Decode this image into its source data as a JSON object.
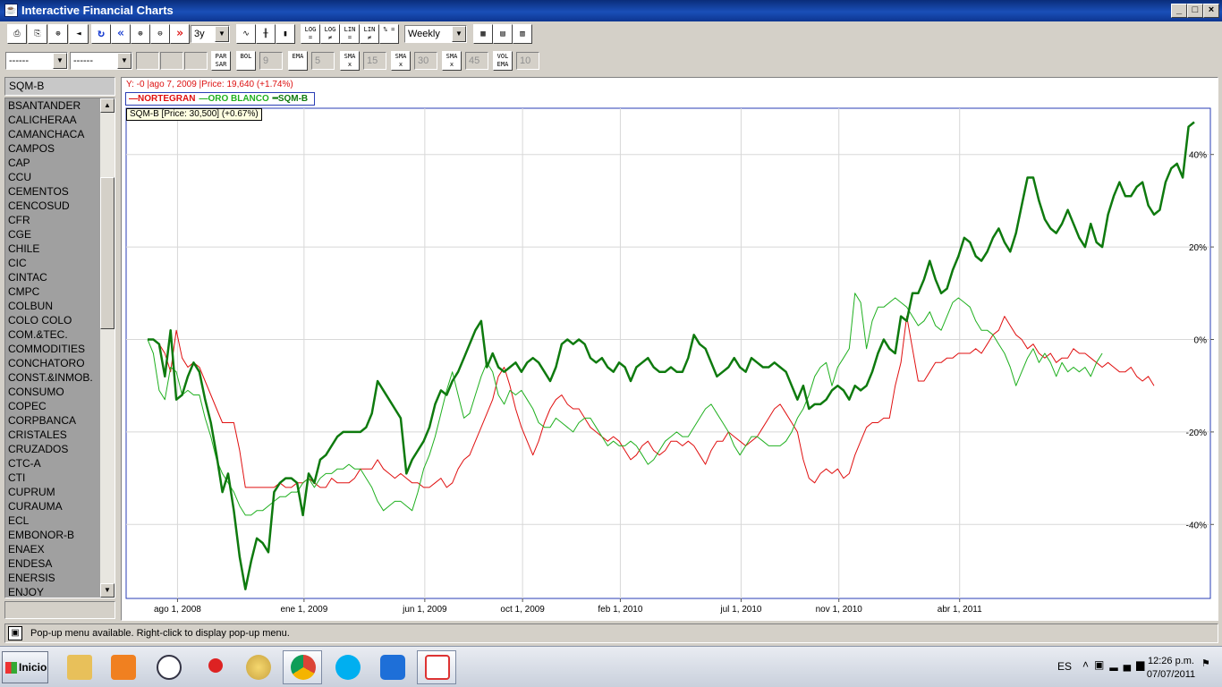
{
  "window": {
    "title": "Interactive Financial Charts",
    "app_icon": "java-icon"
  },
  "toolbar1": {
    "buttons": [
      {
        "name": "print-icon",
        "glyph": "⎙"
      },
      {
        "name": "print-preview-icon",
        "glyph": "⎘"
      },
      {
        "name": "crosshair-icon",
        "glyph": "⊕"
      },
      {
        "name": "sound-icon",
        "glyph": "◄"
      },
      {
        "name": "refresh-icon",
        "glyph": "↻"
      },
      {
        "name": "back-icon",
        "glyph": "«"
      },
      {
        "name": "zoom-in-icon",
        "glyph": "⊕"
      },
      {
        "name": "zoom-out-icon",
        "glyph": "⊖"
      },
      {
        "name": "forward-icon",
        "glyph": "»"
      }
    ],
    "period": "3y",
    "chart_types": [
      {
        "name": "line-chart-icon",
        "glyph": "∿"
      },
      {
        "name": "ohlc-chart-icon",
        "glyph": "╫"
      },
      {
        "name": "candlestick-icon",
        "glyph": "▮"
      }
    ],
    "scale_buttons": [
      "LOG =",
      "LOG ≠",
      "LIN =",
      "LIN ≠",
      "% ="
    ],
    "interval": "Weekly",
    "view_buttons": [
      {
        "name": "color-settings-icon",
        "glyph": "▦"
      },
      {
        "name": "chart-window-icon",
        "glyph": "▤"
      },
      {
        "name": "chart-window-alt-icon",
        "glyph": "▥"
      }
    ]
  },
  "toolbar2": {
    "select1": "------",
    "select2": "------",
    "indicators": [
      {
        "label": "PAR SAR",
        "value": ""
      },
      {
        "label": "BOL",
        "value": "9"
      },
      {
        "label": "EMA",
        "value": "5"
      },
      {
        "label": "SMA x",
        "value": "15"
      },
      {
        "label": "SMA x",
        "value": "30"
      },
      {
        "label": "SMA x",
        "value": "45"
      },
      {
        "label": "VOL EMA",
        "value": "10"
      }
    ]
  },
  "sidebar": {
    "selected": "SQM-B",
    "items": [
      "BSANTANDER",
      "CALICHERAA",
      "CAMANCHACA",
      "CAMPOS",
      "CAP",
      "CCU",
      "CEMENTOS",
      "CENCOSUD",
      "CFR",
      "CGE",
      "CHILE",
      "CIC",
      "CINTAC",
      "CMPC",
      "COLBUN",
      "COLO COLO",
      "COM.&TEC.",
      "COMMODITIES",
      "CONCHATORO",
      "CONST.&INMOB.",
      "CONSUMO",
      "COPEC",
      "CORPBANCA",
      "CRISTALES",
      "CRUZADOS",
      "CTC-A",
      "CTI",
      "CUPRUM",
      "CURAUMA",
      "ECL",
      "EMBONOR-B",
      "ENAEX",
      "ENDESA",
      "ENERSIS",
      "ENJOY"
    ]
  },
  "chart": {
    "info_line": "Y: -0 |ago 7, 2009 |Price: 19,640 (+1.74%)",
    "tooltip": "SQM-B [Price: 30,500] (+0.67%)"
  },
  "chart_data": {
    "type": "line",
    "y_axis_position": "right",
    "y_unit": "%",
    "ylim": [
      -56,
      50
    ],
    "yticks": [
      "40%",
      "20%",
      "0%",
      "-20%",
      "-40%"
    ],
    "ytick_values": [
      40,
      20,
      0,
      -20,
      -40
    ],
    "x_labels": [
      "ago 1, 2008",
      "ene 1, 2009",
      "jun 1, 2009",
      "oct 1, 2009",
      "feb 1, 2010",
      "jul 1, 2010",
      "nov 1, 2010",
      "abr 1, 2011"
    ],
    "x_label_weeks": [
      1,
      23,
      44,
      61,
      78,
      99,
      116,
      137
    ],
    "grid": true,
    "legend_position": "top-left",
    "series": [
      {
        "name": "NORTEGRAN",
        "color": "#e01010",
        "width": 1,
        "values": [
          0,
          0,
          -1,
          -3,
          -7,
          2,
          -4,
          -6,
          -5,
          -6,
          -9,
          -12,
          -15,
          -18,
          -18,
          -18,
          -24,
          -32,
          -32,
          -32,
          -32,
          -32,
          -32,
          -31,
          -32,
          -32,
          -31,
          -31,
          -30,
          -31,
          -32,
          -32,
          -30,
          -31,
          -31,
          -31,
          -30,
          -28,
          -28,
          -28,
          -26,
          -28,
          -29,
          -30,
          -29,
          -30,
          -31,
          -31,
          -32,
          -32,
          -31,
          -30,
          -32,
          -31,
          -28,
          -26,
          -25,
          -22,
          -19,
          -16,
          -13,
          -8,
          -6,
          -10,
          -15,
          -19,
          -22,
          -25,
          -22,
          -18,
          -15,
          -13,
          -12,
          -14,
          -15,
          -15,
          -17,
          -19,
          -20,
          -21,
          -22,
          -21,
          -22,
          -24,
          -26,
          -25,
          -23,
          -22,
          -24,
          -25,
          -24,
          -22,
          -22,
          -23,
          -22,
          -23,
          -25,
          -27,
          -24,
          -22,
          -22,
          -20,
          -21,
          -22,
          -23,
          -22,
          -21,
          -19,
          -17,
          -15,
          -14,
          -16,
          -18,
          -20,
          -26,
          -30,
          -31,
          -29,
          -28,
          -29,
          -28,
          -30,
          -29,
          -25,
          -22,
          -19,
          -18,
          -18,
          -17,
          -17,
          -10,
          -5,
          5,
          -2,
          -9,
          -9,
          -7,
          -5,
          -5,
          -4,
          -4,
          -3,
          -3,
          -3,
          -2,
          -3,
          -1,
          1,
          2,
          5,
          3,
          1,
          0,
          -2,
          -1,
          -3,
          -4,
          -3,
          -5,
          -4,
          -4,
          -2,
          -3,
          -3,
          -4,
          -5,
          -6,
          -5,
          -6,
          -7,
          -7,
          -6,
          -8,
          -9,
          -8,
          -10
        ]
      },
      {
        "name": "ORO BLANCO",
        "color": "#20b020",
        "width": 1,
        "values": [
          0,
          -3,
          -11,
          -13,
          -6,
          -7,
          -12,
          -11,
          -12,
          -12,
          -17,
          -21,
          -26,
          -29,
          -31,
          -33,
          -36,
          -38,
          -38,
          -37,
          -37,
          -36,
          -35,
          -34,
          -34,
          -33,
          -33,
          -31,
          -30,
          -32,
          -30,
          -29,
          -29,
          -28,
          -28,
          -27,
          -28,
          -28,
          -30,
          -32,
          -35,
          -37,
          -36,
          -35,
          -35,
          -36,
          -37,
          -33,
          -28,
          -25,
          -21,
          -16,
          -11,
          -7,
          -12,
          -17,
          -16,
          -12,
          -8,
          -5,
          -7,
          -12,
          -14,
          -11,
          -12,
          -11,
          -13,
          -15,
          -18,
          -19,
          -19,
          -17,
          -18,
          -19,
          -20,
          -18,
          -17,
          -17,
          -19,
          -21,
          -23,
          -22,
          -23,
          -23,
          -22,
          -23,
          -25,
          -27,
          -26,
          -24,
          -22,
          -21,
          -20,
          -21,
          -21,
          -19,
          -17,
          -15,
          -14,
          -16,
          -18,
          -20,
          -23,
          -25,
          -23,
          -21,
          -21,
          -22,
          -23,
          -23,
          -23,
          -22,
          -20,
          -17,
          -15,
          -12,
          -8,
          -6,
          -5,
          -10,
          -6,
          -4,
          -2,
          10,
          8,
          -2,
          4,
          7,
          7,
          8,
          9,
          8,
          7,
          5,
          3,
          4,
          6,
          3,
          2,
          5,
          8,
          9,
          8,
          7,
          4,
          2,
          2,
          1,
          -1,
          -3,
          -6,
          -10,
          -7,
          -4,
          -2,
          -5,
          -3,
          -5,
          -8,
          -5,
          -7,
          -6,
          -7,
          -6,
          -8,
          -5,
          -3
        ]
      },
      {
        "name": "SQM-B",
        "color": "#0e7a0e",
        "width": 2.5,
        "values": [
          0,
          0,
          -1,
          -8,
          2,
          -13,
          -12,
          -8,
          -5,
          -7,
          -13,
          -18,
          -25,
          -33,
          -29,
          -37,
          -47,
          -54,
          -48,
          -43,
          -44,
          -46,
          -33,
          -31,
          -30,
          -30,
          -31,
          -38,
          -29,
          -31,
          -26,
          -25,
          -23,
          -21,
          -20,
          -20,
          -20,
          -20,
          -19,
          -16,
          -9,
          -11,
          -13,
          -15,
          -17,
          -29,
          -26,
          -24,
          -22,
          -19,
          -14,
          -11,
          -12,
          -9,
          -7,
          -4,
          -1,
          2,
          4,
          -6,
          -3,
          -6,
          -7,
          -6,
          -5,
          -7,
          -5,
          -4,
          -5,
          -7,
          -9,
          -6,
          -1,
          0,
          -1,
          0,
          -1,
          -4,
          -5,
          -4,
          -6,
          -7,
          -5,
          -6,
          -9,
          -6,
          -5,
          -4,
          -6,
          -7,
          -7,
          -6,
          -7,
          -7,
          -4,
          1,
          -1,
          -2,
          -5,
          -8,
          -7,
          -6,
          -4,
          -6,
          -7,
          -4,
          -5,
          -6,
          -6,
          -5,
          -6,
          -7,
          -10,
          -13,
          -10,
          -15,
          -14,
          -14,
          -13,
          -11,
          -10,
          -11,
          -13,
          -10,
          -11,
          -10,
          -7,
          -3,
          0,
          -2,
          -3,
          5,
          4,
          10,
          10,
          13,
          17,
          13,
          10,
          11,
          15,
          18,
          22,
          21,
          18,
          17,
          19,
          22,
          24,
          21,
          19,
          23,
          29,
          35,
          35,
          30,
          26,
          24,
          23,
          25,
          28,
          25,
          22,
          20,
          25,
          21,
          20,
          27,
          31,
          34,
          31,
          31,
          33,
          34,
          29,
          27,
          28,
          34,
          37,
          38,
          35,
          46,
          47
        ]
      }
    ]
  },
  "statusbar": {
    "text": "Pop-up menu available. Right-click to display pop-up menu."
  },
  "taskbar": {
    "start_label": "Inicio",
    "apps": [
      "folder-icon",
      "media-player-icon",
      "clock-app-icon",
      "pin-icon",
      "paint-icon",
      "chrome-icon",
      "skype-icon",
      "teamviewer-icon",
      "java-icon"
    ],
    "language": "ES",
    "time": "12:26 p.m.",
    "date": "07/07/2011"
  }
}
